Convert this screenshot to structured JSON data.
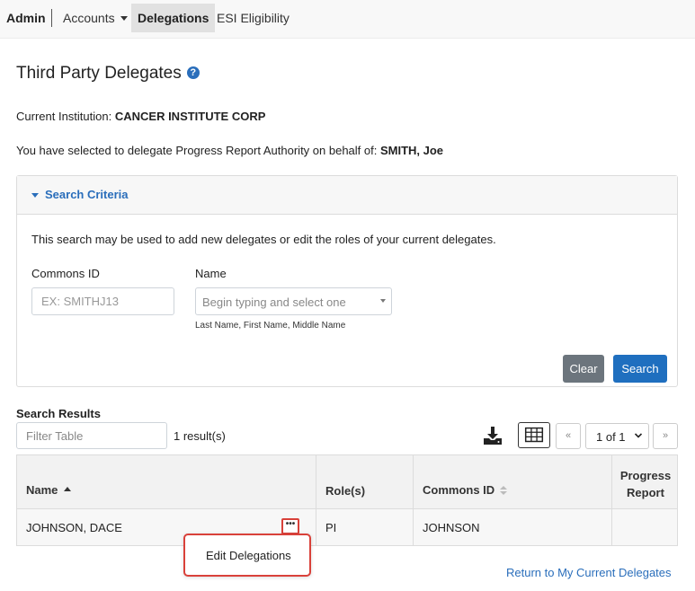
{
  "nav": {
    "admin": "Admin",
    "accounts": "Accounts",
    "delegations": "Delegations",
    "esi": "ESI Eligibility"
  },
  "page": {
    "title": "Third Party Delegates",
    "help_icon": "?",
    "institution_label": "Current Institution:",
    "institution_value": "CANCER INSTITUTE CORP",
    "delegate_text": "You have selected to delegate Progress Report Authority on behalf of:",
    "delegate_value": "SMITH, Joe"
  },
  "search": {
    "title": "Search Criteria",
    "description": "This search may be used to add new delegates or edit the roles of your current delegates.",
    "commons_label": "Commons ID",
    "commons_placeholder": "EX: SMITHJ13",
    "name_label": "Name",
    "name_placeholder": "Begin typing and select one",
    "name_help": "Last Name, First Name, Middle Name",
    "clear_label": "Clear",
    "search_label": "Search"
  },
  "results": {
    "title": "Search Results",
    "filter_placeholder": "Filter Table",
    "count": "1 result(s)",
    "pagination": {
      "prev": "«",
      "page": "1 of 1",
      "next": "»"
    },
    "columns": [
      "Name",
      "Role(s)",
      "Commons ID",
      "Progress Report"
    ],
    "rows": [
      {
        "name": "JOHNSON, DACE",
        "role": "PI",
        "commons_id": "JOHNSON",
        "progress": ""
      }
    ],
    "more_label": "•••",
    "menu_items": [
      "Edit Delegations"
    ],
    "return_link": "Return to My Current Delegates"
  },
  "icons": {
    "download": "download-icon",
    "grid": "grid-icon",
    "help": "help-icon",
    "more": "more-icon"
  },
  "colors": {
    "link": "#2a6ebb",
    "primary_button": "#1f6fbf",
    "secondary_button": "#6c757d",
    "highlight": "#d9413a"
  }
}
